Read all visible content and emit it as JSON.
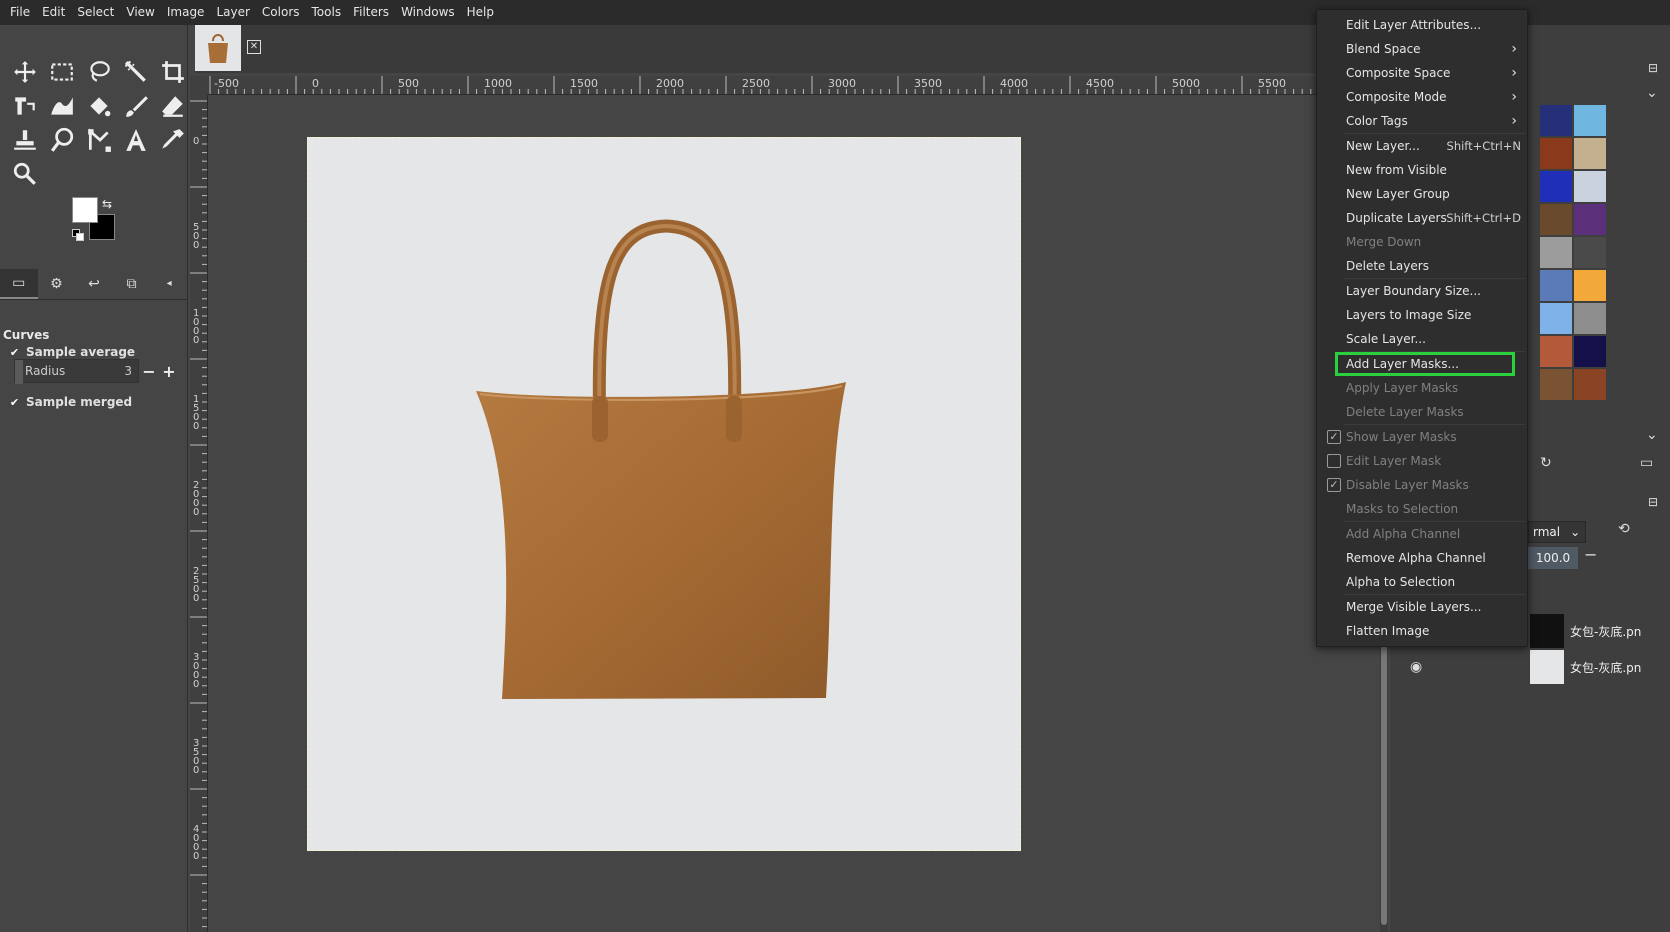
{
  "menubar": [
    "File",
    "Edit",
    "Select",
    "View",
    "Image",
    "Layer",
    "Colors",
    "Tools",
    "Filters",
    "Windows",
    "Help"
  ],
  "tool_options": {
    "title": "Curves",
    "sample_average_label": "Sample average",
    "radius_label": "Radius",
    "radius_value": "3",
    "sample_merged_label": "Sample merged"
  },
  "ruler": {
    "h_labels": [
      "-500",
      "0",
      "500",
      "1000",
      "1500",
      "2000",
      "2500",
      "3000",
      "3500",
      "4000",
      "4500",
      "5000",
      "5500"
    ],
    "v_labels": [
      "0",
      "500",
      "1000",
      "1500",
      "2000",
      "2500",
      "3000",
      "3500",
      "4000"
    ]
  },
  "context_menu": {
    "items": [
      {
        "label": "Edit Layer Attributes..."
      },
      {
        "label": "Blend Space",
        "submenu": true
      },
      {
        "label": "Composite Space",
        "submenu": true
      },
      {
        "label": "Composite Mode",
        "submenu": true
      },
      {
        "label": "Color Tags",
        "submenu": true
      },
      {
        "sep": true
      },
      {
        "label": "New Layer...",
        "shortcut": "Shift+Ctrl+N"
      },
      {
        "label": "New from Visible"
      },
      {
        "label": "New Layer Group"
      },
      {
        "label": "Duplicate Layers",
        "shortcut": "Shift+Ctrl+D"
      },
      {
        "label": "Merge Down",
        "disabled": true
      },
      {
        "label": "Delete Layers"
      },
      {
        "sep": true
      },
      {
        "label": "Layer Boundary Size..."
      },
      {
        "label": "Layers to Image Size"
      },
      {
        "label": "Scale Layer..."
      },
      {
        "sep": true
      },
      {
        "label": "Add Layer Masks...",
        "highlighted": true
      },
      {
        "label": "Apply Layer Masks",
        "disabled": true
      },
      {
        "label": "Delete Layer Masks",
        "disabled": true
      },
      {
        "sep": true
      },
      {
        "label": "Show Layer Masks",
        "disabled": true,
        "checkbox": true,
        "checked": true
      },
      {
        "label": "Edit Layer Mask",
        "disabled": true,
        "checkbox": true,
        "checked": false
      },
      {
        "label": "Disable Layer Masks",
        "disabled": true,
        "checkbox": true,
        "checked": true
      },
      {
        "label": "Masks to Selection",
        "disabled": true
      },
      {
        "sep": true
      },
      {
        "label": "Add Alpha Channel",
        "disabled": true
      },
      {
        "label": "Remove Alpha Channel"
      },
      {
        "label": "Alpha to Selection"
      },
      {
        "sep": true
      },
      {
        "label": "Merge Visible Layers..."
      },
      {
        "label": "Flatten Image"
      }
    ]
  },
  "layers_panel": {
    "mode_label": "rmal",
    "opacity_value": "100.0",
    "layers": [
      {
        "name": "女包-灰底.pn"
      },
      {
        "name": "女包-灰底.pn"
      }
    ]
  },
  "colors": {
    "highlight_outline": "#2bd13c",
    "bag": "#a86e37",
    "canvas_bg": "#e5e6e8"
  }
}
